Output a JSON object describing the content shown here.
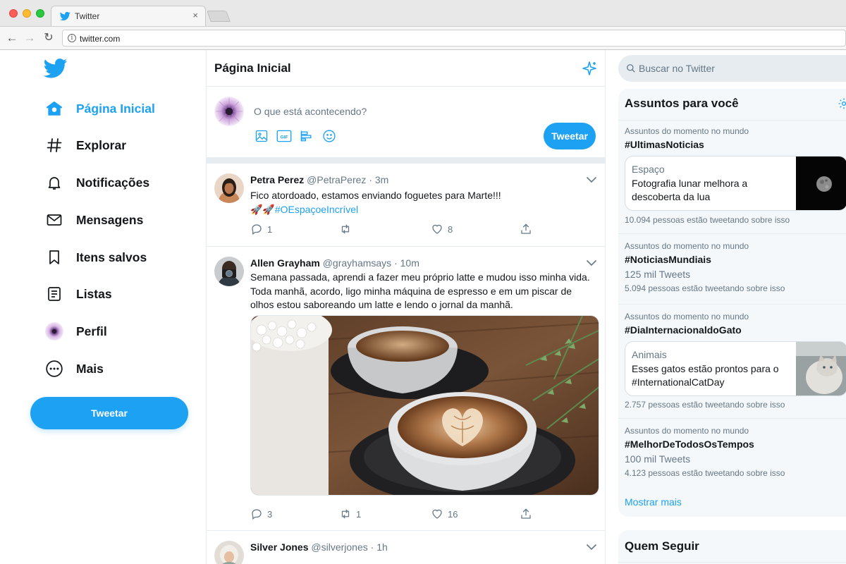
{
  "browser": {
    "tab_title": "Twitter",
    "tab_close": "×",
    "url": "twitter.com"
  },
  "nav": {
    "items": [
      {
        "label": "Página Inicial",
        "icon": "home-icon",
        "active": true
      },
      {
        "label": "Explorar",
        "icon": "hashtag-icon"
      },
      {
        "label": "Notificações",
        "icon": "bell-icon"
      },
      {
        "label": "Mensagens",
        "icon": "envelope-icon"
      },
      {
        "label": "Itens salvos",
        "icon": "bookmark-icon"
      },
      {
        "label": "Listas",
        "icon": "list-icon"
      },
      {
        "label": "Perfil",
        "icon": "avatar"
      },
      {
        "label": "Mais",
        "icon": "more-icon"
      }
    ],
    "tweet_button": "Tweetar"
  },
  "feed": {
    "title": "Página Inicial",
    "composer": {
      "placeholder": "O que está acontecendo?",
      "button": "Tweetar",
      "tools": [
        "image-icon",
        "gif-icon",
        "poll-icon",
        "emoji-icon"
      ]
    },
    "tweets": [
      {
        "name": "Petra Perez",
        "handle": "@PetraPerez",
        "time": "· 3m",
        "text": "Fico atordoado, estamos enviando foguetes para Marte!!!",
        "emoji": "🚀🚀",
        "hashtag": "#OEspaçoeIncrível",
        "replies": "1",
        "retweets": "",
        "likes": "8"
      },
      {
        "name": "Allen Grayham",
        "handle": "@grayhamsays",
        "time": "· 10m",
        "text": "Semana passada, aprendi a fazer meu próprio latte e mudou isso minha vida. Toda manhã, acordo, ligo minha máquina de espresso e em um piscar de olhos estou saboreando um latte e lendo o jornal da manhã.",
        "replies": "3",
        "retweets": "1",
        "likes": "16"
      },
      {
        "name": "Silver Jones",
        "handle": "@silverjones",
        "time": "· 1h"
      }
    ]
  },
  "search": {
    "placeholder": "Buscar no Twitter"
  },
  "trends": {
    "title": "Assuntos para você",
    "items": [
      {
        "context": "Assuntos do momento no mundo",
        "tag": "#UltimasNoticias",
        "card": {
          "category": "Espaço",
          "headline": "Fotografia lunar melhora a descoberta da lua"
        },
        "talking": "10.094 pessoas estão tweetando sobre isso"
      },
      {
        "context": "Assuntos do momento no mundo",
        "tag": "#NoticiasMundiais",
        "count": "125 mil Tweets",
        "talking": "5.094 pessoas estão tweetando sobre isso"
      },
      {
        "context": "Assuntos do momento no mundo",
        "tag": "#DiaInternacionaldoGato",
        "card": {
          "category": "Animais",
          "headline": "Esses gatos estão prontos para o #InternationalCatDay"
        },
        "talking": "2.757 pessoas estão tweetando sobre isso"
      },
      {
        "context": "Assuntos do momento no mundo",
        "tag": "#MelhorDeTodosOsTempos",
        "count": "100 mil Tweets",
        "talking": "4.123 pessoas estão tweetando sobre isso"
      }
    ],
    "show_more": "Mostrar mais"
  },
  "who_to_follow": {
    "title": "Quem Seguir"
  },
  "colors": {
    "accent": "#1da1f2",
    "text": "#14171a",
    "muted": "#657786",
    "border": "#e6ecf0"
  }
}
